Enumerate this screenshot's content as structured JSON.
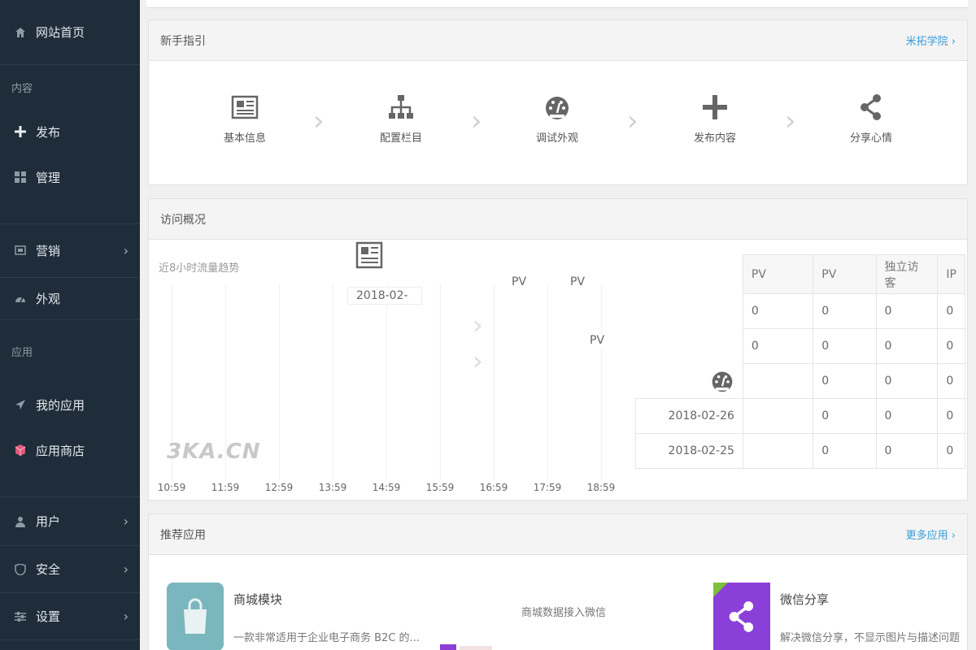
{
  "sidebar": {
    "home": {
      "label": "网站首页",
      "icon": "home-icon"
    },
    "section_content": "内容",
    "publish": {
      "label": "发布",
      "icon": "plus-icon"
    },
    "manage": {
      "label": "管理",
      "icon": "grid-icon"
    },
    "marketing": {
      "label": "营销",
      "icon": "billboard-icon"
    },
    "appearance": {
      "label": "外观",
      "icon": "dashboard-icon"
    },
    "section_apps": "应用",
    "my_apps": {
      "label": "我的应用",
      "icon": "paper-plane-icon"
    },
    "app_store": {
      "label": "应用商店",
      "icon": "cube-icon"
    },
    "users": {
      "label": "用户",
      "icon": "user-icon"
    },
    "security": {
      "label": "安全",
      "icon": "shield-icon"
    },
    "settings": {
      "label": "设置",
      "icon": "sliders-icon"
    }
  },
  "guide": {
    "title": "新手指引",
    "more": "米拓学院 ›",
    "steps": [
      {
        "label": "基本信息",
        "icon": "newspaper-icon"
      },
      {
        "label": "配置栏目",
        "icon": "sitemap-icon"
      },
      {
        "label": "调试外观",
        "icon": "dashboard-icon"
      },
      {
        "label": "发布内容",
        "icon": "plus-icon"
      },
      {
        "label": "分享心情",
        "icon": "share-icon"
      }
    ]
  },
  "visits": {
    "title": "访问概况",
    "subtitle": "近8小时流量趋势",
    "xticks": [
      "10:59",
      "11:59",
      "12:59",
      "13:59",
      "14:59",
      "15:59",
      "16:59",
      "17:59",
      "18:59"
    ],
    "table": {
      "headers": [
        "PV",
        "PV",
        "独立访客",
        "IP"
      ],
      "rows": [
        [
          "",
          "0",
          "0",
          "0",
          "0"
        ],
        [
          "",
          "0",
          "0",
          "0",
          "0"
        ],
        [
          "",
          "",
          "0",
          "0",
          "0"
        ],
        [
          "2018-02-26",
          "",
          "0",
          "0",
          "0"
        ],
        [
          "2018-02-25",
          "",
          "0",
          "0",
          "0"
        ]
      ]
    },
    "ghost": {
      "date": "2018-02-",
      "pv1": "PV",
      "pv2": "PV",
      "pv3": "PV"
    },
    "watermark": "3KA.CN"
  },
  "recommend": {
    "title": "推荐应用",
    "more": "更多应用 ›",
    "apps": [
      {
        "title": "商城模块",
        "desc": "一款非常适用于企业电子商务 B2C 的..."
      },
      {
        "title": "",
        "desc": "商城数据接入微信"
      },
      {
        "title": "微信分享",
        "desc": "解决微信分享，不显示图片与描述问题"
      }
    ]
  }
}
